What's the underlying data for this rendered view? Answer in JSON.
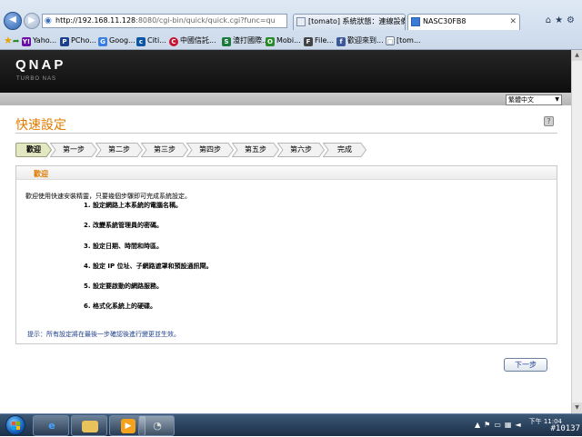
{
  "browser": {
    "address": {
      "host": "http://192.168.11.128",
      "path": ":8080/cgi-bin/quick/quick.cgi?func=qu"
    },
    "tabs": [
      {
        "label": "[tomato] 系統狀態：連線設備..."
      },
      {
        "label": "NASC30FB8"
      }
    ],
    "bookmarks": [
      {
        "label": "Yaho...",
        "icon": "Y!",
        "color": "#6b0ea8"
      },
      {
        "label": "PCho...",
        "icon": "P",
        "color": "#1b3f8b"
      },
      {
        "label": "Goog...",
        "icon": "G",
        "color": "#3a7fe0"
      },
      {
        "label": "Citi...",
        "icon": "c",
        "color": "#0a56a3"
      },
      {
        "label": "中國信託...",
        "icon": "C",
        "color": "#c8102e"
      },
      {
        "label": "渣打國際...",
        "icon": "S",
        "color": "#1a7a3d"
      },
      {
        "label": "Mobi...",
        "icon": "O",
        "color": "#2a8a2a"
      },
      {
        "label": "File...",
        "icon": "F",
        "color": "#444444"
      },
      {
        "label": "歡迎來到...",
        "icon": "f",
        "color": "#3b5998"
      },
      {
        "label": "[tom...",
        "icon": "□",
        "color": "#6f7f95"
      }
    ]
  },
  "header": {
    "logo": "QNAP",
    "subtitle": "TURBO NAS",
    "language": "繁體中文"
  },
  "page": {
    "title": "快速設定",
    "steps": [
      "歡迎",
      "第一步",
      "第二步",
      "第三步",
      "第四步",
      "第五步",
      "第六步",
      "完成"
    ],
    "active_step": 0,
    "panel_title": "歡迎",
    "intro": "歡迎使用快速安裝精靈，只要幾個步驟即可完成系統設定。",
    "items": [
      "1. 設定網路上本系統的電腦名稱。",
      "2. 改變系統管理員的密碼。",
      "3. 設定日期、時間和時區。",
      "4. 設定 IP 位址、子網路遮罩和預設通訊閘。",
      "5. 設定要啟動的網路服務。",
      "6. 格式化系統上的硬碟。"
    ],
    "hint": "提示：所有設定將在最後一步確認後進行變更並生效。",
    "next_label": "下一步"
  },
  "taskbar": {
    "clock_time": "下午 11:04",
    "watermark": "#10137"
  },
  "colors": {
    "accent": "#e07b00",
    "step_active": "#e3e7c2",
    "step_inactive": "#f2f2f2"
  }
}
